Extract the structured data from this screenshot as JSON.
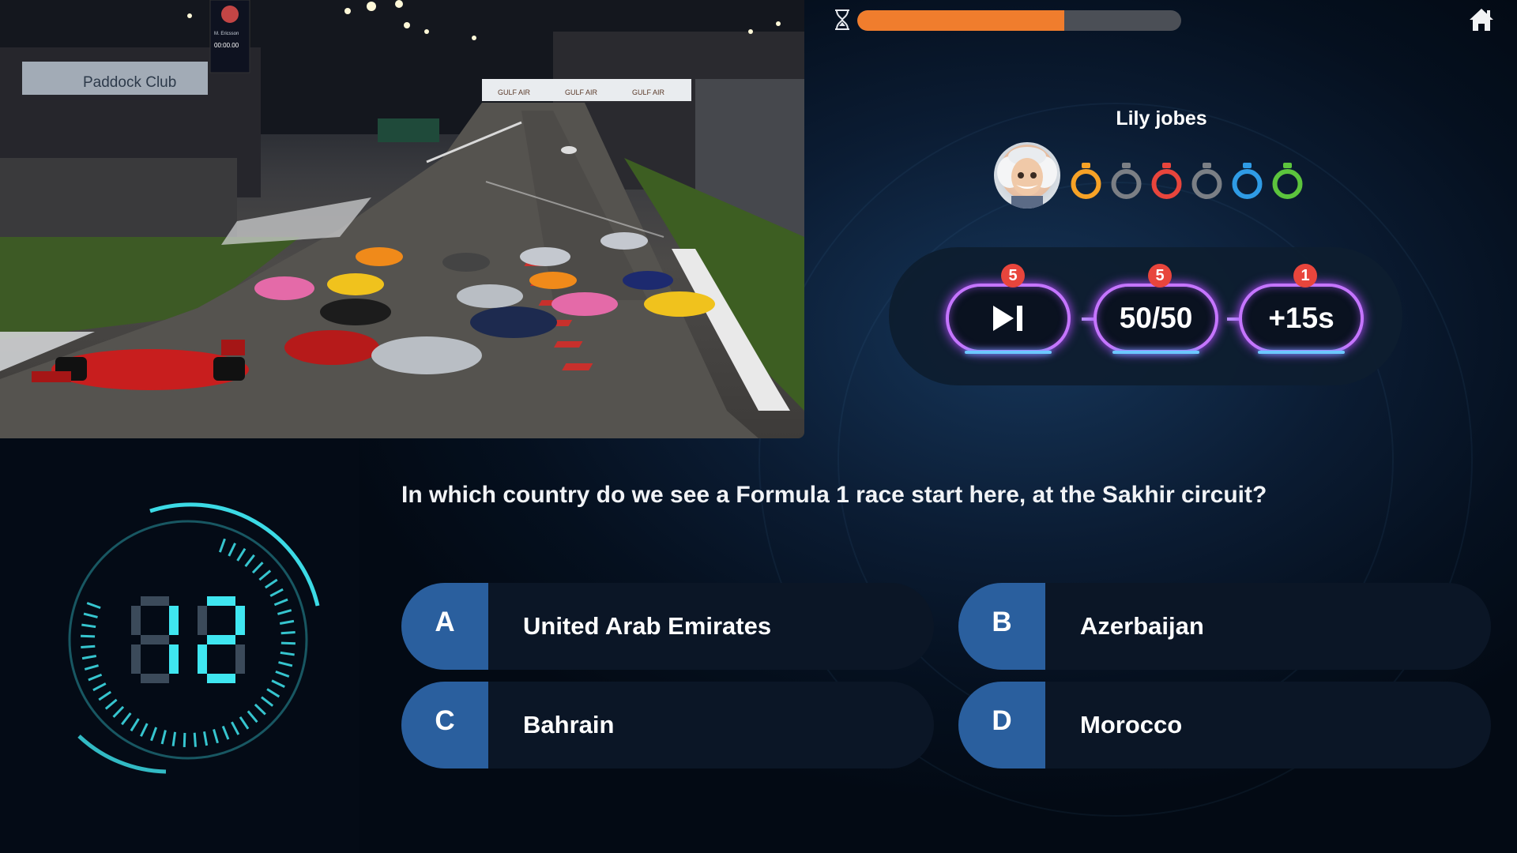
{
  "photo": {
    "paddock_sign": "Paddock Club",
    "scoreboard_name": "M. Ericsson",
    "scoreboard_time": "00:00.00",
    "banner": [
      "GULF AIR",
      "GULF AIR",
      "GULF AIR"
    ]
  },
  "progress": {
    "value": 0.64,
    "color": "#f07d2d"
  },
  "player": {
    "name": "Lily jobes",
    "lives_colors": [
      "#f7a226",
      "#7b7f85",
      "#e8453c",
      "#7b7f85",
      "#2f9be5",
      "#5cc43d"
    ]
  },
  "lifelines": [
    {
      "id": "skip",
      "icon": "skip-icon",
      "count": "5"
    },
    {
      "id": "fifty",
      "label": "50/50",
      "count": "5"
    },
    {
      "id": "time",
      "label": "+15s",
      "count": "1"
    }
  ],
  "question": "In which country do we see a Formula 1 race start here, at the Sakhir circuit?",
  "answers": [
    {
      "letter": "A",
      "text": "United Arab Emirates"
    },
    {
      "letter": "B",
      "text": "Azerbaijan"
    },
    {
      "letter": "C",
      "text": "Bahrain"
    },
    {
      "letter": "D",
      "text": "Morocco"
    }
  ],
  "timer": {
    "value": "12",
    "color": "#3fe6f0"
  }
}
